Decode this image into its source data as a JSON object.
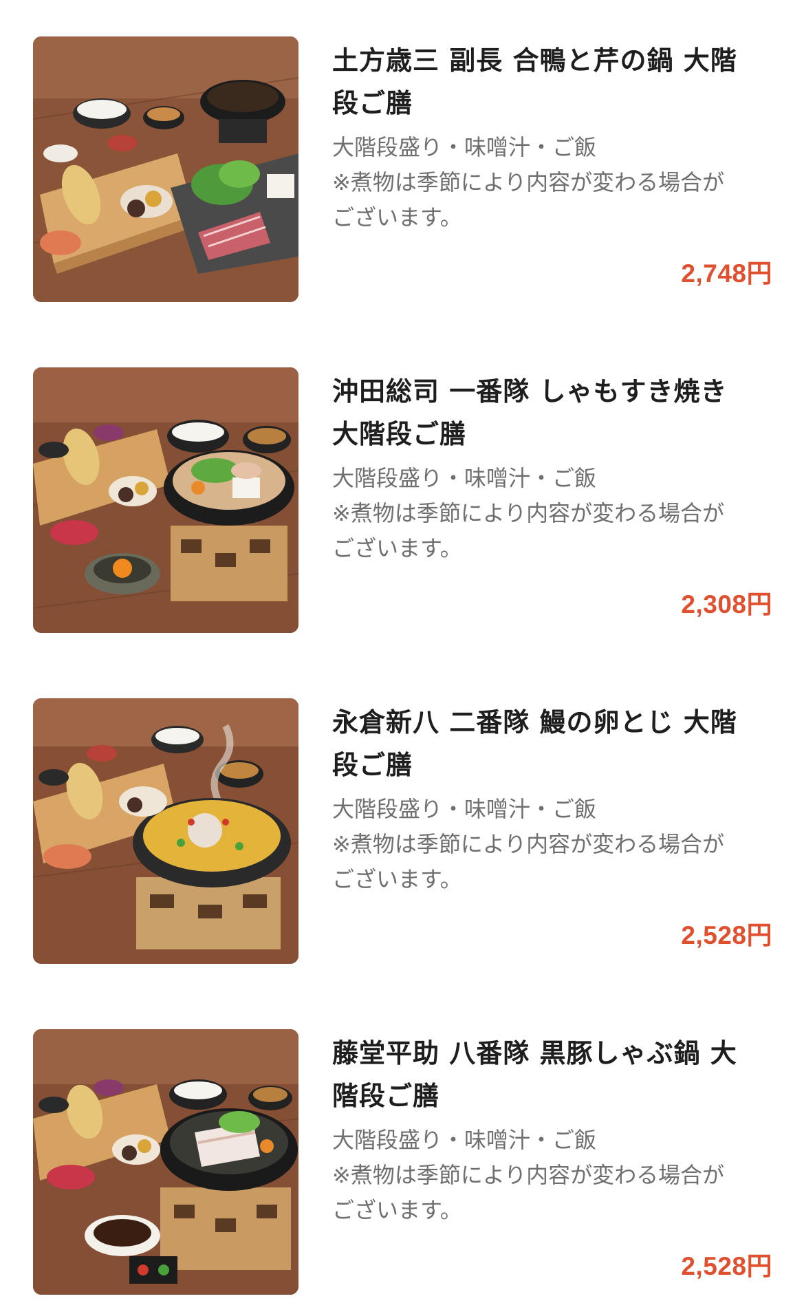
{
  "items": [
    {
      "title_line1": "土方歳三 副長 合鴨と芹の鍋 大階",
      "title_line2": "段ご膳",
      "desc_line1": "大階段盛り・味噌汁・ご飯",
      "desc_line2": "※煮物は季節により内容が変わる場合が",
      "desc_line3": "ございます。",
      "price": "2,748円"
    },
    {
      "title_line1": "沖田総司 一番隊 しゃもすき焼き",
      "title_line2": "大階段ご膳",
      "desc_line1": "大階段盛り・味噌汁・ご飯",
      "desc_line2": "※煮物は季節により内容が変わる場合が",
      "desc_line3": "ございます。",
      "price": "2,308円"
    },
    {
      "title_line1": "永倉新八 二番隊 鰻の卵とじ 大階",
      "title_line2": "段ご膳",
      "desc_line1": "大階段盛り・味噌汁・ご飯",
      "desc_line2": "※煮物は季節により内容が変わる場合が",
      "desc_line3": "ございます。",
      "price": "2,528円"
    },
    {
      "title_line1": "藤堂平助 八番隊 黒豚しゃぶ鍋 大",
      "title_line2": "階段ご膳",
      "desc_line1": "大階段盛り・味噌汁・ご飯",
      "desc_line2": "※煮物は季節により内容が変わる場合が",
      "desc_line3": "ございます。",
      "price": "2,528円"
    }
  ],
  "colors": {
    "price": "#e0502e",
    "title": "#1e1e1e",
    "description": "#6f6f6f",
    "table_wood": "#7a4a33"
  }
}
